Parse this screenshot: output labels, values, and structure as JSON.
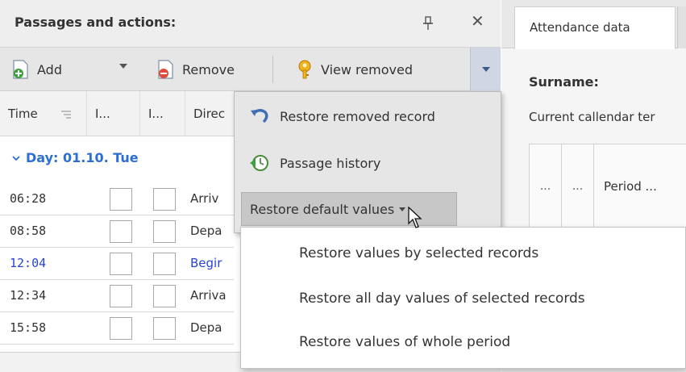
{
  "left_pane": {
    "title": "Passages and actions:",
    "toolbar": {
      "add_label": "Add",
      "remove_label": "Remove",
      "view_removed_label": "View removed"
    },
    "columns": [
      "Time",
      "I...",
      "I...",
      "Direc"
    ],
    "group": {
      "label": "Day: 01.10. Tue"
    },
    "rows": [
      {
        "time": "06:28",
        "direction": "Arriv"
      },
      {
        "time": "08:58",
        "direction": "Depa"
      },
      {
        "time": "12:04",
        "direction": "Begir"
      },
      {
        "time": "12:34",
        "direction": "Arriva"
      },
      {
        "time": "15:58",
        "direction": "Depa"
      }
    ]
  },
  "menu": {
    "items": [
      {
        "label": "Restore removed record",
        "icon": "undo-arrow-icon"
      },
      {
        "label": "Passage history",
        "icon": "clock-history-icon"
      },
      {
        "label": "Restore default values",
        "icon": ""
      }
    ]
  },
  "submenu": {
    "items": [
      "Restore values by selected records",
      "Restore all day values of selected records",
      "Restore values of whole period"
    ]
  },
  "right_pane": {
    "tab": "Attendance data",
    "surname_label": "Surname:",
    "calendar_label": "Current callendar ter",
    "grid_columns": [
      "...",
      "...",
      "Period ..."
    ]
  },
  "colors": {
    "accent_blue": "#2c6fd1",
    "link_blue": "#2a43d6",
    "menu_bg": "#e6e6e6",
    "active_bg": "#c7c7c7"
  }
}
